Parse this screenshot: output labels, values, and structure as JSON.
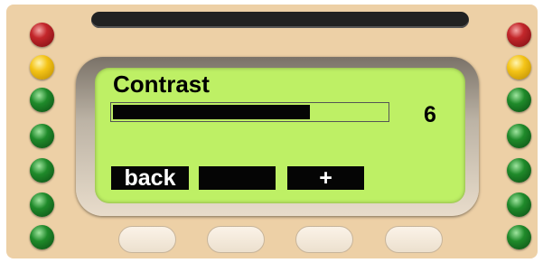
{
  "screen": {
    "title": "Contrast",
    "value": "6",
    "level": 0.715,
    "softkeys": {
      "left": "back",
      "middle": "",
      "right": "+"
    }
  },
  "leds": {
    "left": [
      "red",
      "yellow",
      "green",
      "green",
      "green",
      "green",
      "green"
    ],
    "right": [
      "red",
      "yellow",
      "green",
      "green",
      "green",
      "green",
      "green"
    ]
  },
  "colors": {
    "panel": "#edd0a6",
    "lcd": "#bef065",
    "led_red": "#c3272b",
    "led_yellow": "#f4c417",
    "led_green": "#1f8a2a"
  }
}
